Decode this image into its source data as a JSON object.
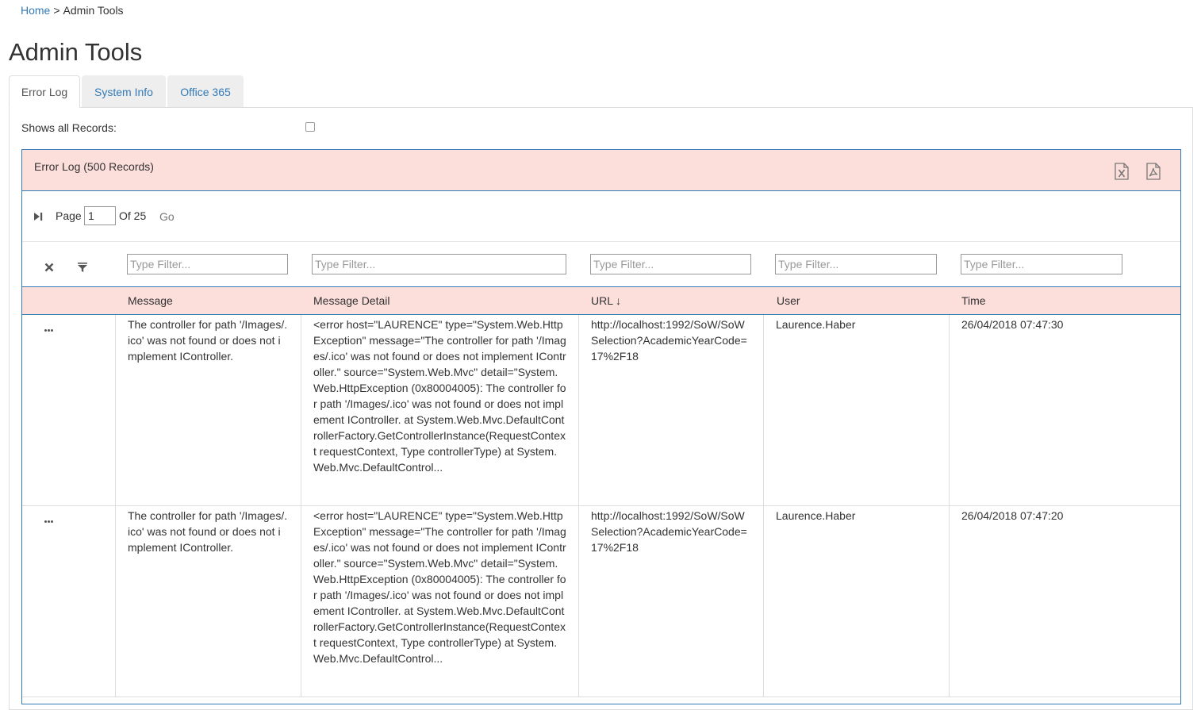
{
  "breadcrumb": {
    "home": "Home",
    "separator": ">",
    "current": "Admin Tools"
  },
  "page": {
    "title": "Admin Tools"
  },
  "tabs": [
    {
      "label": "Error Log",
      "active": true
    },
    {
      "label": "System Info",
      "active": false
    },
    {
      "label": "Office 365",
      "active": false
    }
  ],
  "options": {
    "shows_all_records_label": "Shows all Records:",
    "shows_all_records_checked": false
  },
  "grid": {
    "title": "Error Log (500 Records)",
    "export_icons": [
      "excel-export-icon",
      "pdf-export-icon"
    ],
    "pager": {
      "page_label": "Page",
      "page_value": "1",
      "of_label": "Of 25",
      "go_label": "Go"
    },
    "filter_placeholder": "Type Filter...",
    "columns": [
      {
        "label": "Message",
        "sort": ""
      },
      {
        "label": "Message Detail",
        "sort": ""
      },
      {
        "label": "URL",
        "sort": "↓"
      },
      {
        "label": "User",
        "sort": ""
      },
      {
        "label": "Time",
        "sort": ""
      }
    ],
    "rows": [
      {
        "message": "The controller for path '/Images/.ico' was not found or does not implement IController.",
        "detail": "<error host=\"LAURENCE\" type=\"System.Web.HttpException\" message=\"The controller for path '/Images/.ico' was not found or does not implement IController.\" source=\"System.Web.Mvc\" detail=\"System.Web.HttpException (0x80004005): The controller for path '/Images/.ico' was not found or does not implement IController. at System.Web.Mvc.DefaultControllerFactory.GetControllerInstance(RequestContext requestContext, Type controllerType) at System.Web.Mvc.DefaultControl...",
        "url": "http://localhost:1992/SoW/SoWSelection?AcademicYearCode=17%2F18",
        "user": "Laurence.Haber",
        "time": "26/04/2018 07:47:30"
      },
      {
        "message": "The controller for path '/Images/.ico' was not found or does not implement IController.",
        "detail": "<error host=\"LAURENCE\" type=\"System.Web.HttpException\" message=\"The controller for path '/Images/.ico' was not found or does not implement IController.\" source=\"System.Web.Mvc\" detail=\"System.Web.HttpException (0x80004005): The controller for path '/Images/.ico' was not found or does not implement IController. at System.Web.Mvc.DefaultControllerFactory.GetControllerInstance(RequestContext requestContext, Type controllerType) at System.Web.Mvc.DefaultControl...",
        "url": "http://localhost:1992/SoW/SoWSelection?AcademicYearCode=17%2F18",
        "user": "Laurence.Haber",
        "time": "26/04/2018 07:47:20"
      }
    ]
  }
}
